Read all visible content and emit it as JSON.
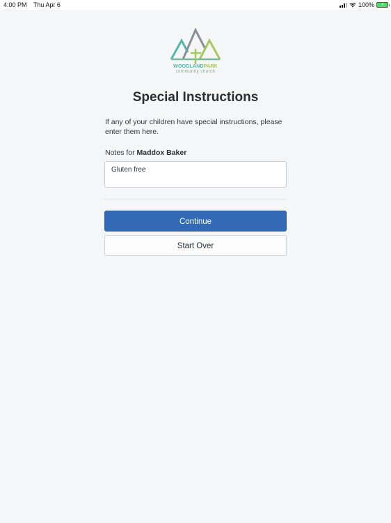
{
  "status_bar": {
    "time": "4:00 PM",
    "date": "Thu Apr 6",
    "battery": "100%",
    "icons": [
      "cellular-signal-icon",
      "wifi-icon",
      "battery-charging-icon"
    ]
  },
  "logo": {
    "word_part1": "WOODLAND",
    "word_part2": "PARK",
    "subtitle": "community church",
    "colors": [
      "#54b7a8",
      "#a5c95a",
      "#8a8f95"
    ]
  },
  "page": {
    "title": "Special Instructions",
    "description": "If any of your children have special instructions, please enter them here."
  },
  "notes": {
    "label_prefix": "Notes for",
    "child_name": "Maddox Baker",
    "value": "Gluten free"
  },
  "actions": {
    "continue_label": "Continue",
    "start_over_label": "Start Over"
  },
  "colors": {
    "primary": "#336ab5",
    "background": "#f5f6f8"
  }
}
